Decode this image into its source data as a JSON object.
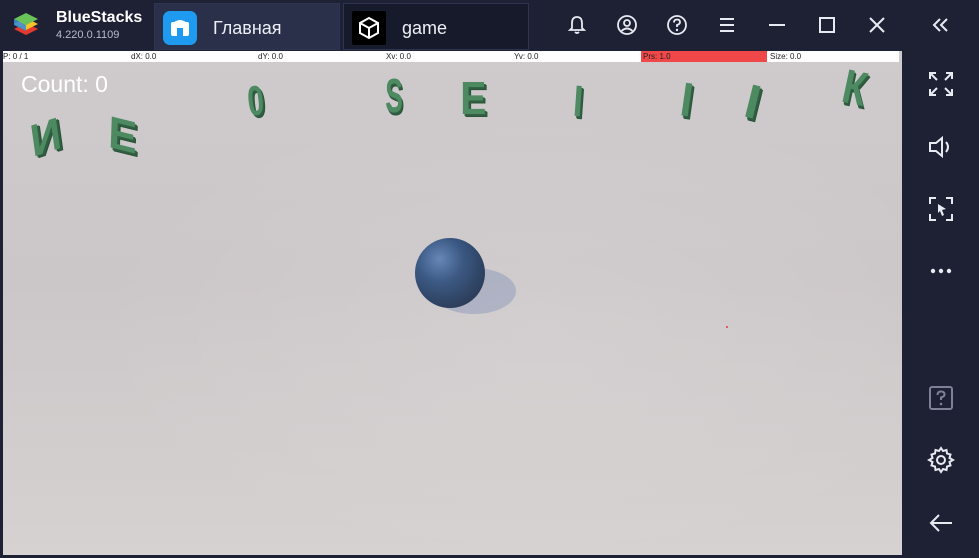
{
  "app": {
    "name": "BlueStacks",
    "version": "4.220.0.1109"
  },
  "tabs": [
    {
      "label": "Главная",
      "icon": "home-icon",
      "active": false
    },
    {
      "label": "game",
      "icon": "unity-icon",
      "active": true
    }
  ],
  "titlebar_buttons": [
    "bell-icon",
    "account-icon",
    "help-icon",
    "menu-icon",
    "minimize-icon",
    "maximize-icon",
    "close-icon",
    "collapse-panel-icon"
  ],
  "sidepanel_buttons": [
    "fullscreen-icon",
    "volume-icon",
    "pointer-mode-icon",
    "more-icon",
    "help-box-icon",
    "settings-icon",
    "back-icon"
  ],
  "debug": {
    "p": "P: 0 / 1",
    "dx": "dX: 0.0",
    "dy": "dY: 0.0",
    "xv": "Xv: 0.0",
    "yv": "Yv: 0.0",
    "prs": "Prs: 1.0",
    "size": "Size: 0.0"
  },
  "game": {
    "count_text": "Count: 0",
    "letters": [
      "И",
      "Е",
      "0",
      "Ѕ",
      "Е",
      "I",
      "I",
      "I",
      "К"
    ]
  },
  "colors": {
    "titlebar": "#1e2134",
    "letter_green": "#4d8a62",
    "ball": "#1e3a64",
    "prs_bar": "#f04848"
  }
}
